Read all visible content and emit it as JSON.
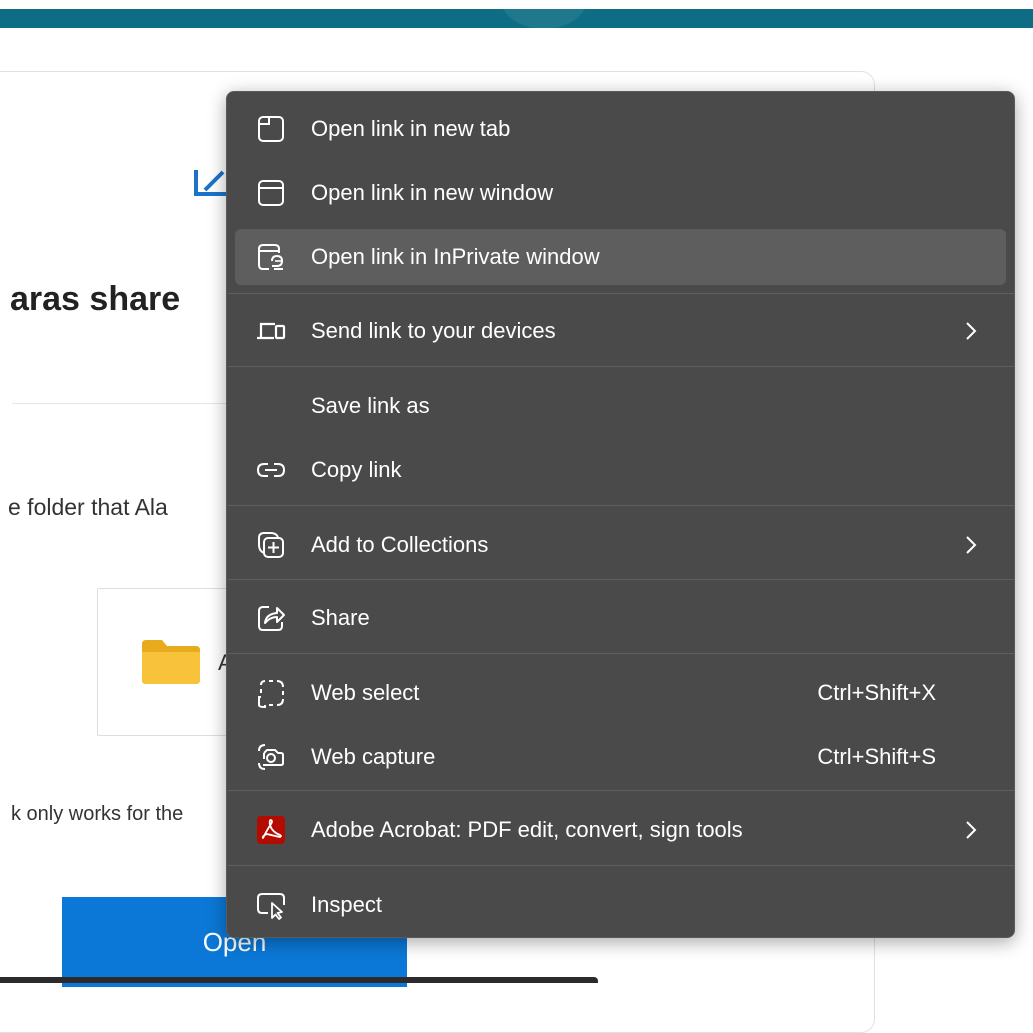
{
  "background_page": {
    "title_partial": "aras share",
    "subtitle_partial": "e folder that Ala",
    "file_name_partial": "A",
    "note_partial": "k only works for the",
    "open_button_label": "Open"
  },
  "context_menu": {
    "items": [
      {
        "label": "Open link in new tab",
        "icon": "new-tab-icon"
      },
      {
        "label": "Open link in new window",
        "icon": "new-window-icon"
      },
      {
        "label": "Open link in InPrivate window",
        "icon": "inprivate-window-icon",
        "highlighted": true
      },
      {
        "label": "Send link to your devices",
        "icon": "devices-icon",
        "submenu": true
      },
      {
        "label": "Save link as"
      },
      {
        "label": "Copy link",
        "icon": "link-icon"
      },
      {
        "label": "Add to Collections",
        "icon": "collections-icon",
        "submenu": true
      },
      {
        "label": "Share",
        "icon": "share-icon"
      },
      {
        "label": "Web select",
        "icon": "web-select-icon",
        "shortcut": "Ctrl+Shift+X"
      },
      {
        "label": "Web capture",
        "icon": "web-capture-icon",
        "shortcut": "Ctrl+Shift+S"
      },
      {
        "label": "Adobe Acrobat: PDF edit, convert, sign tools",
        "icon": "adobe-acrobat-icon",
        "submenu": true
      },
      {
        "label": "Inspect",
        "icon": "inspect-icon"
      }
    ]
  },
  "colors": {
    "menu_background": "#4a4a4a",
    "menu_highlight": "#5e5e5e",
    "top_bar": "#0e6d84",
    "open_button": "#0b78d7",
    "acrobat_red": "#b30b00",
    "folder_yellow": "#f8c33a"
  }
}
